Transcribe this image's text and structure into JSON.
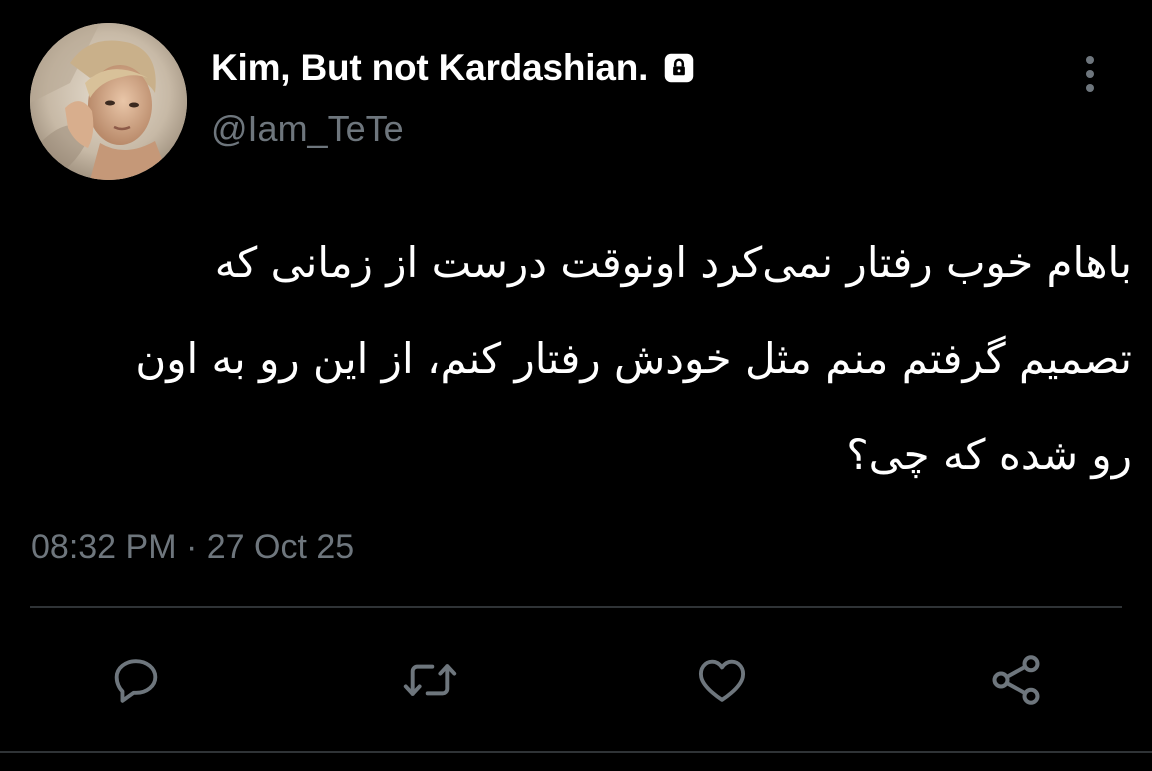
{
  "author": {
    "display_name": "Kim, But not Kardashian.",
    "handle": "@Iam_TeTe",
    "protected_icon": "lock-icon",
    "avatar_icon": "user-avatar-photo"
  },
  "tweet": {
    "text_lines": [
      "باهام خوب رفتار نمی‌کرد اونوقت درست از زمانی که",
      "تصمیم گرفتم منم مثل خودش رفتار کنم، از این رو به اون",
      "رو شده که چی؟"
    ],
    "time": "08:32 PM",
    "separator": "·",
    "date": "27 Oct 25"
  },
  "actions": {
    "reply_icon": "reply-icon",
    "retweet_icon": "retweet-icon",
    "like_icon": "heart-icon",
    "share_icon": "share-icon",
    "more_icon": "more-vertical-icon"
  },
  "colors": {
    "background": "#000000",
    "text_primary": "#ffffff",
    "text_secondary": "#6e767d",
    "divider": "#2f3336",
    "icon": "#6e767d"
  }
}
